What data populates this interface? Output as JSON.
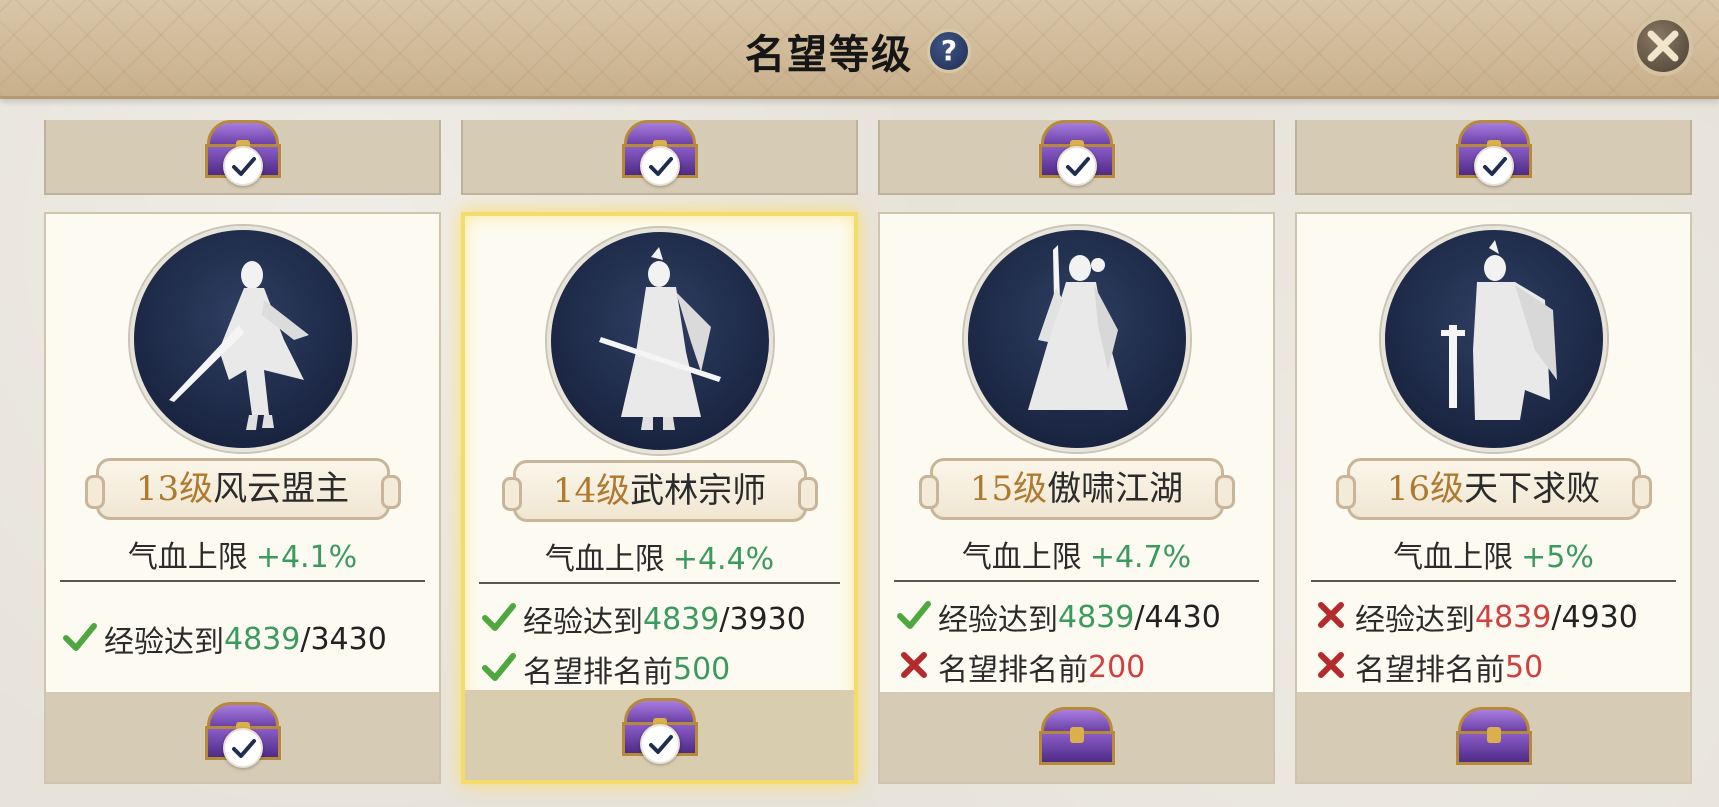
{
  "header": {
    "title": "名望等级",
    "help_label": "?",
    "close_label": "close"
  },
  "colors": {
    "level_text": "#b07a2e",
    "bonus_green": "#3b9a5d",
    "fail_red": "#d13f3f",
    "portrait_bg": "#1f2d52",
    "selected_glow": "#f3dc6b"
  },
  "cards": [
    {
      "level": "13级",
      "rank_name": "风云盟主",
      "attr_label": "气血上限",
      "attr_bonus": "+4.1%",
      "portrait_icon": "swordsman-silhouette-icon",
      "selected": false,
      "requirements": [
        {
          "label": "经验达到",
          "value": "4839",
          "target": "/3430",
          "met": true
        }
      ],
      "top_reward_claimed": true,
      "bottom_reward_claimed": true
    },
    {
      "level": "14级",
      "rank_name": "武林宗师",
      "attr_label": "气血上限",
      "attr_bonus": "+4.4%",
      "portrait_icon": "blademaster-silhouette-icon",
      "selected": true,
      "requirements": [
        {
          "label": "经验达到",
          "value": "4839",
          "target": "/3930",
          "met": true
        },
        {
          "label": "名望排名前",
          "value": "500",
          "target": "",
          "met": true
        }
      ],
      "top_reward_claimed": true,
      "bottom_reward_claimed": true
    },
    {
      "level": "15级",
      "rank_name": "傲啸江湖",
      "attr_label": "气血上限",
      "attr_bonus": "+4.7%",
      "portrait_icon": "sage-silhouette-icon",
      "selected": false,
      "requirements": [
        {
          "label": "经验达到",
          "value": "4839",
          "target": "/4430",
          "met": true
        },
        {
          "label": "名望排名前",
          "value": "200",
          "target": "",
          "met": false
        }
      ],
      "top_reward_claimed": true,
      "bottom_reward_claimed": false
    },
    {
      "level": "16级",
      "rank_name": "天下求败",
      "attr_label": "气血上限",
      "attr_bonus": "+5%",
      "portrait_icon": "warlord-silhouette-icon",
      "selected": false,
      "requirements": [
        {
          "label": "经验达到",
          "value": "4839",
          "target": "/4930",
          "met": false
        },
        {
          "label": "名望排名前",
          "value": "50",
          "target": "",
          "met": false
        }
      ],
      "top_reward_claimed": true,
      "bottom_reward_claimed": false
    }
  ]
}
